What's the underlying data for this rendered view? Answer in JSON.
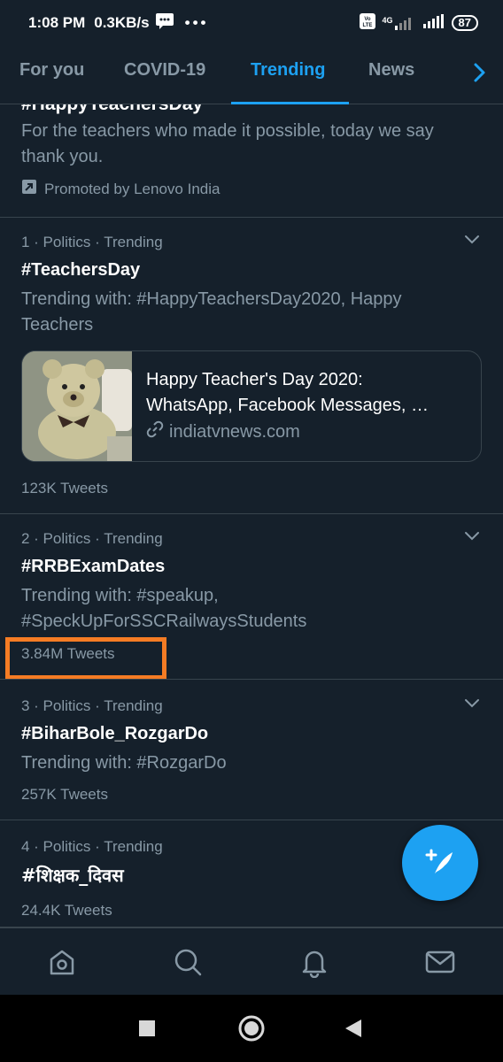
{
  "status": {
    "time": "1:08 PM",
    "speed": "0.3KB/s",
    "battery": "87",
    "network": "4G"
  },
  "tabs": [
    {
      "label": "For you",
      "active": false
    },
    {
      "label": "COVID-19",
      "active": false
    },
    {
      "label": "Trending",
      "active": true
    },
    {
      "label": "News",
      "active": false
    }
  ],
  "promo": {
    "title": "#HappyTeachersDay",
    "description": "For the teachers who made it possible, today we say thank you.",
    "promoted_by": "Promoted by Lenovo India"
  },
  "trends": [
    {
      "meta": "1 · Politics · Trending",
      "tag": "#TeachersDay",
      "with": "Trending with: #HappyTeachersDay2020, Happy Teachers",
      "card": {
        "title": "Happy Teacher's Day 2020:",
        "title2": "WhatsApp, Facebook Messages, …",
        "link": "indiatvnews.com"
      },
      "count": "123K Tweets"
    },
    {
      "meta": "2 · Politics · Trending",
      "tag": "#RRBExamDates",
      "with": "Trending with: #speakup, #SpeckUpForSSCRailwaysStudents",
      "count": "3.84M Tweets"
    },
    {
      "meta": "3 · Politics · Trending",
      "tag": "#BiharBole_RozgarDo",
      "with": "Trending with: #RozgarDo",
      "count": "257K Tweets"
    },
    {
      "meta": "4 · Politics · Trending",
      "tag": "#शिक्षक_दिवस",
      "count": "24.4K Tweets"
    }
  ],
  "colors": {
    "background": "#15202b",
    "accent": "#1da1f2",
    "muted": "#8899a6",
    "highlight": "#f57c24"
  }
}
